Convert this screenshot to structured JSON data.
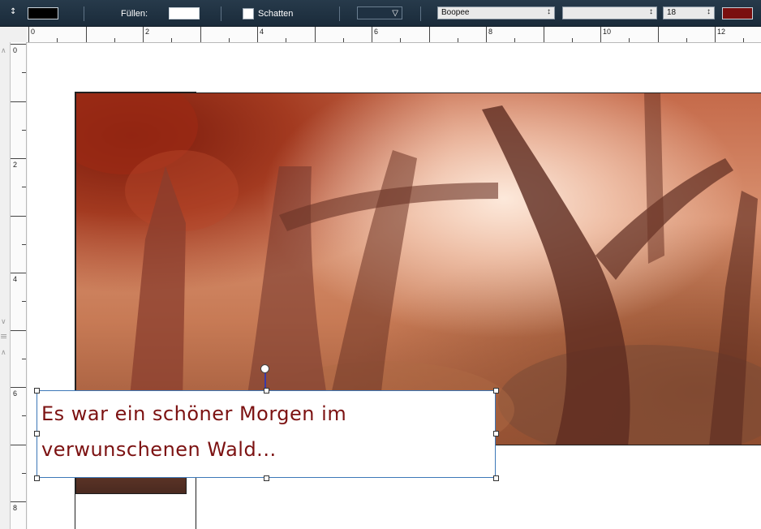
{
  "toolbar": {
    "line_color": "#000000",
    "fill_label": "Füllen:",
    "fill_color": "#ffffff",
    "shadow_label": "Schatten",
    "shadow_checked": false,
    "font_family": "Boopee",
    "font_style": "",
    "font_size": "18",
    "text_color": "#7a0f0f",
    "spin_icon": "up-down-spinner-icon",
    "style_dropdown_icon": "triangle-down-icon"
  },
  "ruler_top": {
    "labels": [
      "0",
      "2",
      "4",
      "6",
      "8",
      "10",
      "12"
    ]
  },
  "ruler_left": {
    "labels": [
      "0",
      "2",
      "4",
      "6",
      "8"
    ]
  },
  "canvas": {
    "image": "autumn-forest-photo",
    "text_box": {
      "lines": [
        "Es war ein schöner Morgen im",
        "verwunschenen Wald..."
      ],
      "color": "#7c1212"
    }
  }
}
